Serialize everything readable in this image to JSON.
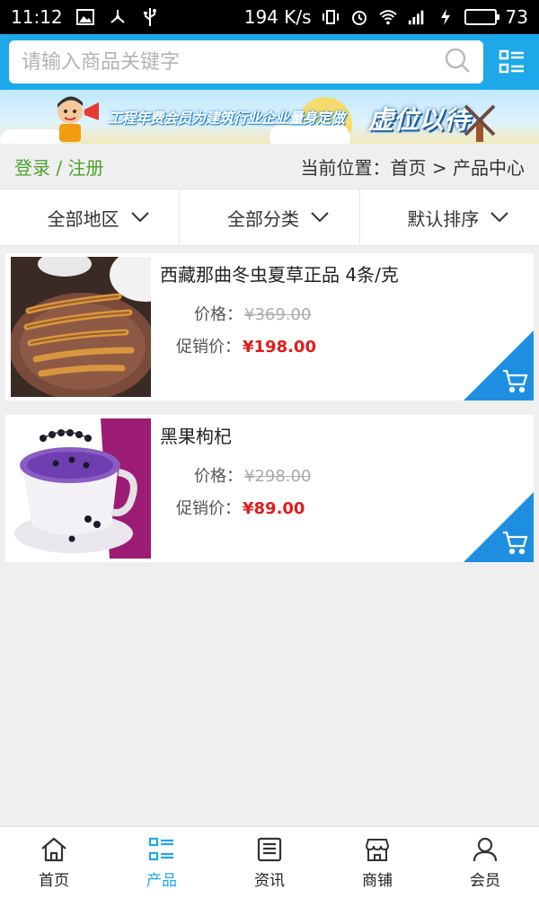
{
  "status_bar": {
    "time": "11:12",
    "net_speed": "194 K/s",
    "battery": "73",
    "battery_fraction": 0.73,
    "network": "4G"
  },
  "search": {
    "placeholder": "请输入商品关键字"
  },
  "banner": {
    "title": "工程年费会员为建筑行业企业量身定做",
    "slogan": "虚位以待"
  },
  "crumb": {
    "login": "登录",
    "separator": " / ",
    "register": "注册",
    "location_label": "当前位置：",
    "home": "首页",
    "arrow": " > ",
    "current": "产品中心"
  },
  "filters": [
    {
      "label": "全部地区"
    },
    {
      "label": "全部分类"
    },
    {
      "label": "默认排序"
    }
  ],
  "products": [
    {
      "name": "西藏那曲冬虫夏草正品 4条/克",
      "price_label": "价格：",
      "price": "¥369.00",
      "sale_label": "促销价：",
      "sale_price": "¥198.00"
    },
    {
      "name": "黑果枸杞",
      "price_label": "价格：",
      "price": "¥298.00",
      "sale_label": "促销价：",
      "sale_price": "¥89.00"
    }
  ],
  "tabs": [
    {
      "label": "首页",
      "icon": "home-icon"
    },
    {
      "label": "产品",
      "icon": "grid-list-icon",
      "active": true
    },
    {
      "label": "资讯",
      "icon": "news-icon"
    },
    {
      "label": "商铺",
      "icon": "store-icon"
    },
    {
      "label": "会员",
      "icon": "user-icon"
    }
  ],
  "colors": {
    "accent": "#1ea8e9",
    "login_green": "#4aa42d",
    "sale_red": "#e01b1b"
  }
}
